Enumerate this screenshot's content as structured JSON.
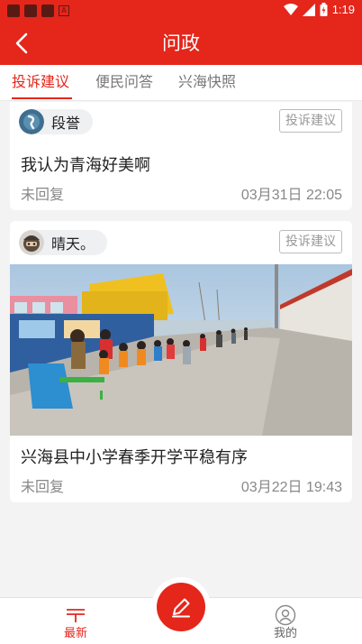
{
  "status_bar": {
    "time": "1:19"
  },
  "header": {
    "title": "问政",
    "back_icon": "back-arrow-icon"
  },
  "tabs": [
    {
      "label": "投诉建议",
      "active": true
    },
    {
      "label": "便民问答",
      "active": false
    },
    {
      "label": "兴海快照",
      "active": false
    }
  ],
  "posts": [
    {
      "user": "段誉",
      "tag": "投诉建议",
      "title": "我认为青海好美啊",
      "status": "未回复",
      "date": "03月31日 22:05",
      "has_photo": false
    },
    {
      "user": "晴天。",
      "tag": "投诉建议",
      "title": "兴海县中小学春季开学平稳有序",
      "status": "未回复",
      "date": "03月22日 19:43",
      "has_photo": true
    }
  ],
  "bottom_nav": {
    "latest_label": "最新",
    "mine_label": "我的",
    "compose_icon": "pencil-icon"
  },
  "colors": {
    "brand": "#e5261b",
    "background": "#f3f3f3"
  }
}
